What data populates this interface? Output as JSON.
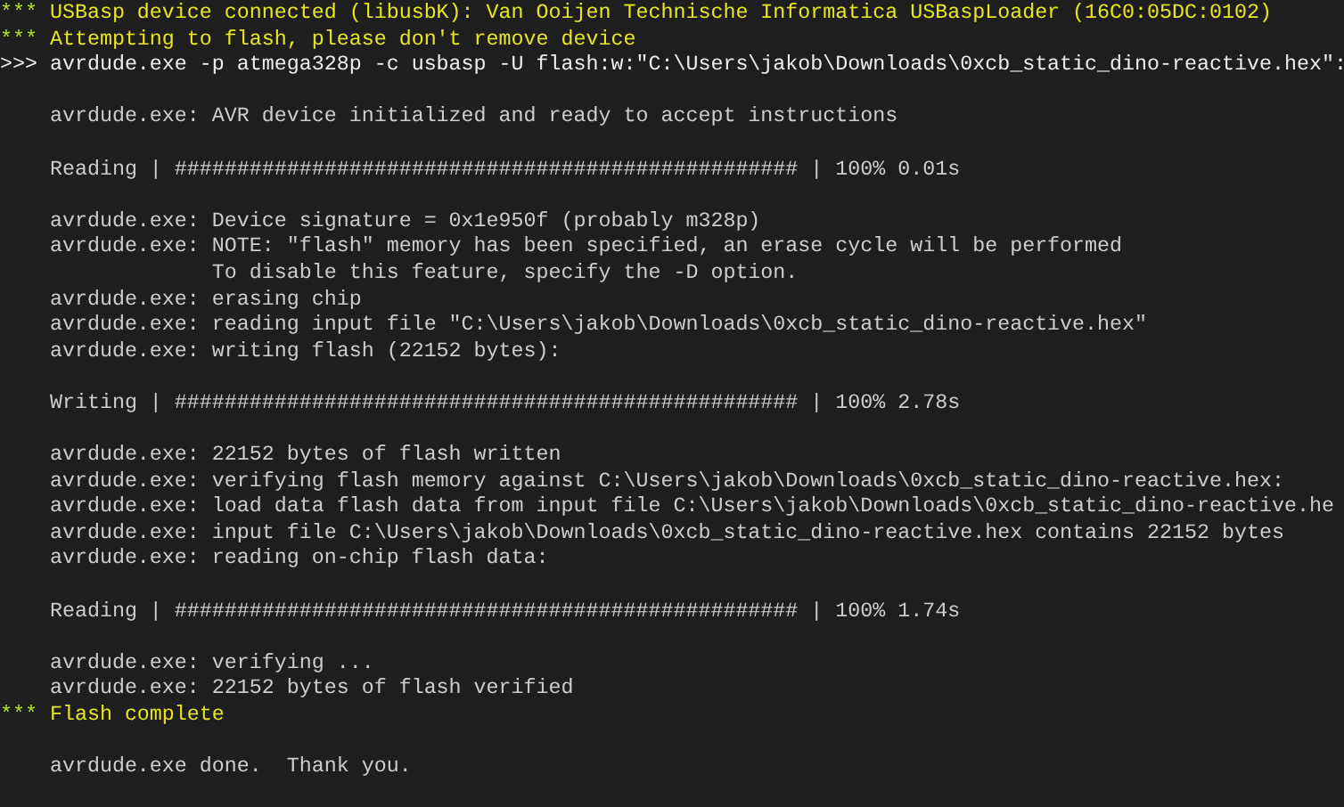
{
  "terminal": {
    "lines": [
      {
        "kind": "banner",
        "marker": "***",
        "text": "USBasp device connected (libusbK): Van Ooijen Technische Informatica USBaspLoader (16C0:05DC:0102)"
      },
      {
        "kind": "banner",
        "marker": "***",
        "text": "Attempting to flash, please don't remove device"
      },
      {
        "kind": "command",
        "marker": ">>>",
        "text": "avrdude.exe -p atmega328p -c usbasp -U flash:w:\"C:\\Users\\jakob\\Downloads\\0xcb_static_dino-reactive.hex\":"
      },
      {
        "kind": "blank"
      },
      {
        "kind": "output",
        "text": "avrdude.exe: AVR device initialized and ready to accept instructions"
      },
      {
        "kind": "blank"
      },
      {
        "kind": "progress",
        "text": "Reading | ################################################## | 100% 0.01s"
      },
      {
        "kind": "blank"
      },
      {
        "kind": "output",
        "text": "avrdude.exe: Device signature = 0x1e950f (probably m328p)"
      },
      {
        "kind": "output",
        "text": "avrdude.exe: NOTE: \"flash\" memory has been specified, an erase cycle will be performed"
      },
      {
        "kind": "continuation",
        "text": "To disable this feature, specify the -D option."
      },
      {
        "kind": "output",
        "text": "avrdude.exe: erasing chip"
      },
      {
        "kind": "output",
        "text": "avrdude.exe: reading input file \"C:\\Users\\jakob\\Downloads\\0xcb_static_dino-reactive.hex\""
      },
      {
        "kind": "output",
        "text": "avrdude.exe: writing flash (22152 bytes):"
      },
      {
        "kind": "blank"
      },
      {
        "kind": "progress",
        "text": "Writing | ################################################## | 100% 2.78s"
      },
      {
        "kind": "blank"
      },
      {
        "kind": "output",
        "text": "avrdude.exe: 22152 bytes of flash written"
      },
      {
        "kind": "output",
        "text": "avrdude.exe: verifying flash memory against C:\\Users\\jakob\\Downloads\\0xcb_static_dino-reactive.hex:"
      },
      {
        "kind": "output",
        "text": "avrdude.exe: load data flash data from input file C:\\Users\\jakob\\Downloads\\0xcb_static_dino-reactive.he"
      },
      {
        "kind": "output",
        "text": "avrdude.exe: input file C:\\Users\\jakob\\Downloads\\0xcb_static_dino-reactive.hex contains 22152 bytes"
      },
      {
        "kind": "output",
        "text": "avrdude.exe: reading on-chip flash data:"
      },
      {
        "kind": "blank"
      },
      {
        "kind": "progress",
        "text": "Reading | ################################################## | 100% 1.74s"
      },
      {
        "kind": "blank"
      },
      {
        "kind": "output",
        "text": "avrdude.exe: verifying ..."
      },
      {
        "kind": "output",
        "text": "avrdude.exe: 22152 bytes of flash verified"
      },
      {
        "kind": "banner",
        "marker": "***",
        "text": "Flash complete"
      },
      {
        "kind": "blank"
      },
      {
        "kind": "output",
        "text": "avrdude.exe done.  Thank you."
      }
    ]
  }
}
